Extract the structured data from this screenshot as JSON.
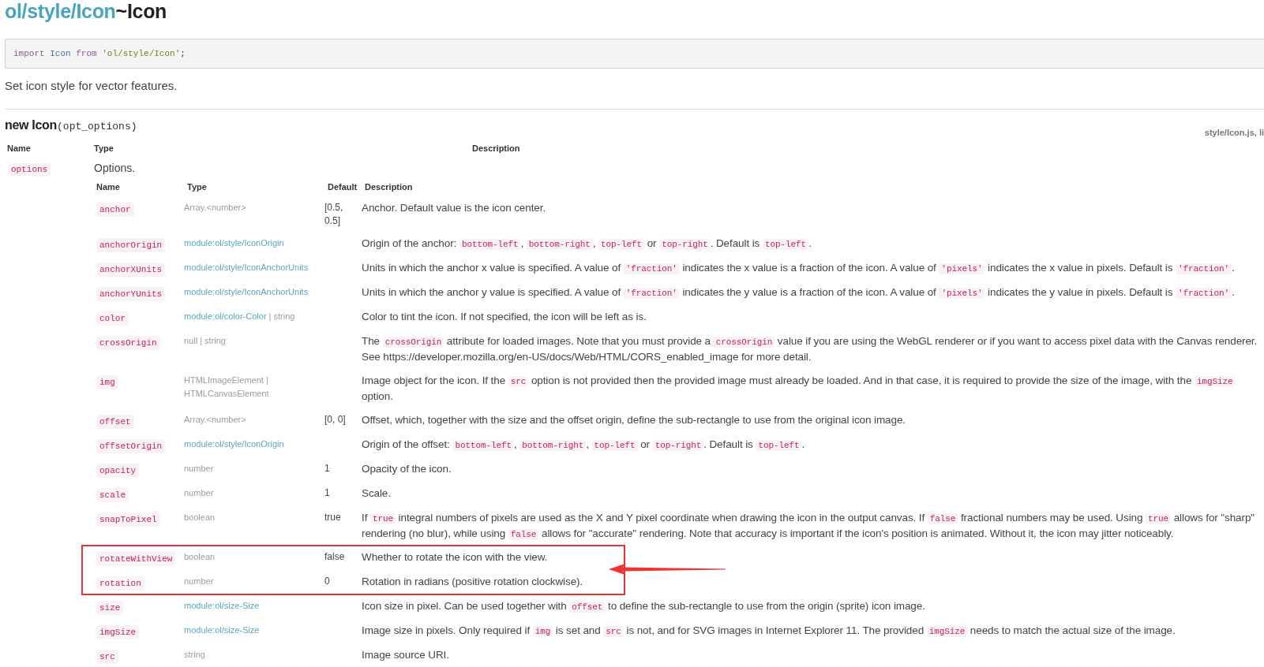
{
  "title": {
    "module": "ol/style/Icon",
    "name": "~Icon"
  },
  "import_code": [
    {
      "kind": "keyword",
      "text": "import"
    },
    {
      "kind": "name",
      "text": " Icon "
    },
    {
      "kind": "keyword",
      "text": "from"
    },
    {
      "kind": "string",
      "text": " 'ol/style/Icon'"
    },
    {
      "kind": "punct",
      "text": ";"
    }
  ],
  "summary": "Set icon style for vector features.",
  "constructor": {
    "name": "new Icon",
    "params": "(opt_options)",
    "source": "style/Icon.js, li"
  },
  "params_table": {
    "columns": [
      "Name",
      "Type",
      "Description"
    ],
    "rows": [
      {
        "name": "options",
        "type": "Options.",
        "properties": {
          "columns": [
            "Name",
            "Type",
            "Default",
            "Description"
          ],
          "rows": [
            {
              "name": "anchor",
              "type": [
                {
                  "text": "Array.<number>",
                  "link": false
                }
              ],
              "default": "[0.5, 0.5]",
              "description": [
                {
                  "kind": "text",
                  "text": "Anchor. Default value is the icon center."
                }
              ],
              "highlighted": false
            },
            {
              "name": "anchorOrigin",
              "type": [
                {
                  "text": "module:ol/style/IconOrigin",
                  "link": true
                }
              ],
              "description": [
                {
                  "kind": "text",
                  "text": "Origin of the anchor: "
                },
                {
                  "kind": "code",
                  "text": "bottom-left"
                },
                {
                  "kind": "text",
                  "text": ", "
                },
                {
                  "kind": "code",
                  "text": "bottom-right"
                },
                {
                  "kind": "text",
                  "text": ", "
                },
                {
                  "kind": "code",
                  "text": "top-left"
                },
                {
                  "kind": "text",
                  "text": " or "
                },
                {
                  "kind": "code",
                  "text": "top-right"
                },
                {
                  "kind": "text",
                  "text": ". Default is "
                },
                {
                  "kind": "code",
                  "text": "top-left"
                },
                {
                  "kind": "text",
                  "text": "."
                }
              ],
              "highlighted": false
            },
            {
              "name": "anchorXUnits",
              "type": [
                {
                  "text": "module:ol/style/IconAnchorUnits",
                  "link": true
                }
              ],
              "description": [
                {
                  "kind": "text",
                  "text": "Units in which the anchor x value is specified. A value of "
                },
                {
                  "kind": "code",
                  "text": "'fraction'"
                },
                {
                  "kind": "text",
                  "text": " indicates the x value is a fraction of the icon. A value of "
                },
                {
                  "kind": "code",
                  "text": "'pixels'"
                },
                {
                  "kind": "text",
                  "text": " indicates the x value in pixels. Default is "
                },
                {
                  "kind": "code",
                  "text": "'fraction'"
                },
                {
                  "kind": "text",
                  "text": "."
                }
              ],
              "highlighted": false
            },
            {
              "name": "anchorYUnits",
              "type": [
                {
                  "text": "module:ol/style/IconAnchorUnits",
                  "link": true
                }
              ],
              "description": [
                {
                  "kind": "text",
                  "text": "Units in which the anchor y value is specified. A value of "
                },
                {
                  "kind": "code",
                  "text": "'fraction'"
                },
                {
                  "kind": "text",
                  "text": " indicates the y value is a fraction of the icon. A value of "
                },
                {
                  "kind": "code",
                  "text": "'pixels'"
                },
                {
                  "kind": "text",
                  "text": " indicates the y value in pixels. Default is "
                },
                {
                  "kind": "code",
                  "text": "'fraction'"
                },
                {
                  "kind": "text",
                  "text": "."
                }
              ],
              "highlighted": false
            },
            {
              "name": "color",
              "type": [
                {
                  "text": "module:ol/color-Color",
                  "link": true
                },
                {
                  "text": " | string",
                  "link": false
                }
              ],
              "description": [
                {
                  "kind": "text",
                  "text": "Color to tint the icon. If not specified, the icon will be left as is."
                }
              ],
              "highlighted": false
            },
            {
              "name": "crossOrigin",
              "type": [
                {
                  "text": "null | string",
                  "link": false
                }
              ],
              "description": [
                {
                  "kind": "text",
                  "text": "The "
                },
                {
                  "kind": "code",
                  "text": "crossOrigin"
                },
                {
                  "kind": "text",
                  "text": " attribute for loaded images. Note that you must provide a "
                },
                {
                  "kind": "code",
                  "text": "crossOrigin"
                },
                {
                  "kind": "text",
                  "text": " value if you are using the WebGL renderer or if you want to access pixel data with the Canvas renderer. See https://developer.mozilla.org/en-US/docs/Web/HTML/CORS_enabled_image for more detail."
                }
              ],
              "highlighted": false
            },
            {
              "name": "img",
              "type": [
                {
                  "text": "HTMLImageElement | HTMLCanvasElement",
                  "link": false
                }
              ],
              "description": [
                {
                  "kind": "text",
                  "text": "Image object for the icon. If the "
                },
                {
                  "kind": "code",
                  "text": "src"
                },
                {
                  "kind": "text",
                  "text": " option is not provided then the provided image must already be loaded. And in that case, it is required to provide the size of the image, with the "
                },
                {
                  "kind": "code",
                  "text": "imgSize"
                },
                {
                  "kind": "text",
                  "text": " option."
                }
              ],
              "highlighted": false
            },
            {
              "name": "offset",
              "type": [
                {
                  "text": "Array.<number>",
                  "link": false
                }
              ],
              "default": "[0, 0]",
              "description": [
                {
                  "kind": "text",
                  "text": "Offset, which, together with the size and the offset origin, define the sub-rectangle to use from the original icon image."
                }
              ],
              "highlighted": false
            },
            {
              "name": "offsetOrigin",
              "type": [
                {
                  "text": "module:ol/style/IconOrigin",
                  "link": true
                }
              ],
              "description": [
                {
                  "kind": "text",
                  "text": "Origin of the offset: "
                },
                {
                  "kind": "code",
                  "text": "bottom-left"
                },
                {
                  "kind": "text",
                  "text": ", "
                },
                {
                  "kind": "code",
                  "text": "bottom-right"
                },
                {
                  "kind": "text",
                  "text": ", "
                },
                {
                  "kind": "code",
                  "text": "top-left"
                },
                {
                  "kind": "text",
                  "text": " or "
                },
                {
                  "kind": "code",
                  "text": "top-right"
                },
                {
                  "kind": "text",
                  "text": ". Default is "
                },
                {
                  "kind": "code",
                  "text": "top-left"
                },
                {
                  "kind": "text",
                  "text": "."
                }
              ],
              "highlighted": false
            },
            {
              "name": "opacity",
              "type": [
                {
                  "text": "number",
                  "link": false
                }
              ],
              "default": "1",
              "description": [
                {
                  "kind": "text",
                  "text": "Opacity of the icon."
                }
              ],
              "highlighted": false
            },
            {
              "name": "scale",
              "type": [
                {
                  "text": "number",
                  "link": false
                }
              ],
              "default": "1",
              "description": [
                {
                  "kind": "text",
                  "text": "Scale."
                }
              ],
              "highlighted": false
            },
            {
              "name": "snapToPixel",
              "type": [
                {
                  "text": "boolean",
                  "link": false
                }
              ],
              "default": "true",
              "description": [
                {
                  "kind": "text",
                  "text": "If "
                },
                {
                  "kind": "code",
                  "text": "true"
                },
                {
                  "kind": "text",
                  "text": " integral numbers of pixels are used as the X and Y pixel coordinate when drawing the icon in the output canvas. If "
                },
                {
                  "kind": "code",
                  "text": "false"
                },
                {
                  "kind": "text",
                  "text": " fractional numbers may be used. Using "
                },
                {
                  "kind": "code",
                  "text": "true"
                },
                {
                  "kind": "text",
                  "text": " allows for \"sharp\" rendering (no blur), while using "
                },
                {
                  "kind": "code",
                  "text": "false"
                },
                {
                  "kind": "text",
                  "text": " allows for \"accurate\" rendering. Note that accuracy is important if the icon's position is animated. Without it, the icon may jitter noticeably."
                }
              ],
              "highlighted": false
            },
            {
              "name": "rotateWithView",
              "type": [
                {
                  "text": "boolean",
                  "link": false
                }
              ],
              "default": "false",
              "description": [
                {
                  "kind": "text",
                  "text": "Whether to rotate the icon with the view."
                }
              ],
              "highlighted": true
            },
            {
              "name": "rotation",
              "type": [
                {
                  "text": "number",
                  "link": false
                }
              ],
              "default": "0",
              "description": [
                {
                  "kind": "text",
                  "text": "Rotation in radians (positive rotation clockwise)."
                }
              ],
              "highlighted": true
            },
            {
              "name": "size",
              "type": [
                {
                  "text": "module:ol/size-Size",
                  "link": true
                }
              ],
              "description": [
                {
                  "kind": "text",
                  "text": "Icon size in pixel. Can be used together with "
                },
                {
                  "kind": "code",
                  "text": "offset"
                },
                {
                  "kind": "text",
                  "text": " to define the sub-rectangle to use from the origin (sprite) icon image."
                }
              ],
              "highlighted": false
            },
            {
              "name": "imgSize",
              "type": [
                {
                  "text": "module:ol/size-Size",
                  "link": true
                }
              ],
              "description": [
                {
                  "kind": "text",
                  "text": "Image size in pixels. Only required if "
                },
                {
                  "kind": "code",
                  "text": "img"
                },
                {
                  "kind": "text",
                  "text": " is set and "
                },
                {
                  "kind": "code",
                  "text": "src"
                },
                {
                  "kind": "text",
                  "text": " is not, and for SVG images in Internet Explorer 11. The provided "
                },
                {
                  "kind": "code",
                  "text": "imgSize"
                },
                {
                  "kind": "text",
                  "text": " needs to match the actual size of the image."
                }
              ],
              "highlighted": false
            },
            {
              "name": "src",
              "type": [
                {
                  "text": "string",
                  "link": false
                }
              ],
              "description": [
                {
                  "kind": "text",
                  "text": "Image source URI."
                }
              ],
              "highlighted": false
            }
          ]
        }
      }
    ]
  }
}
